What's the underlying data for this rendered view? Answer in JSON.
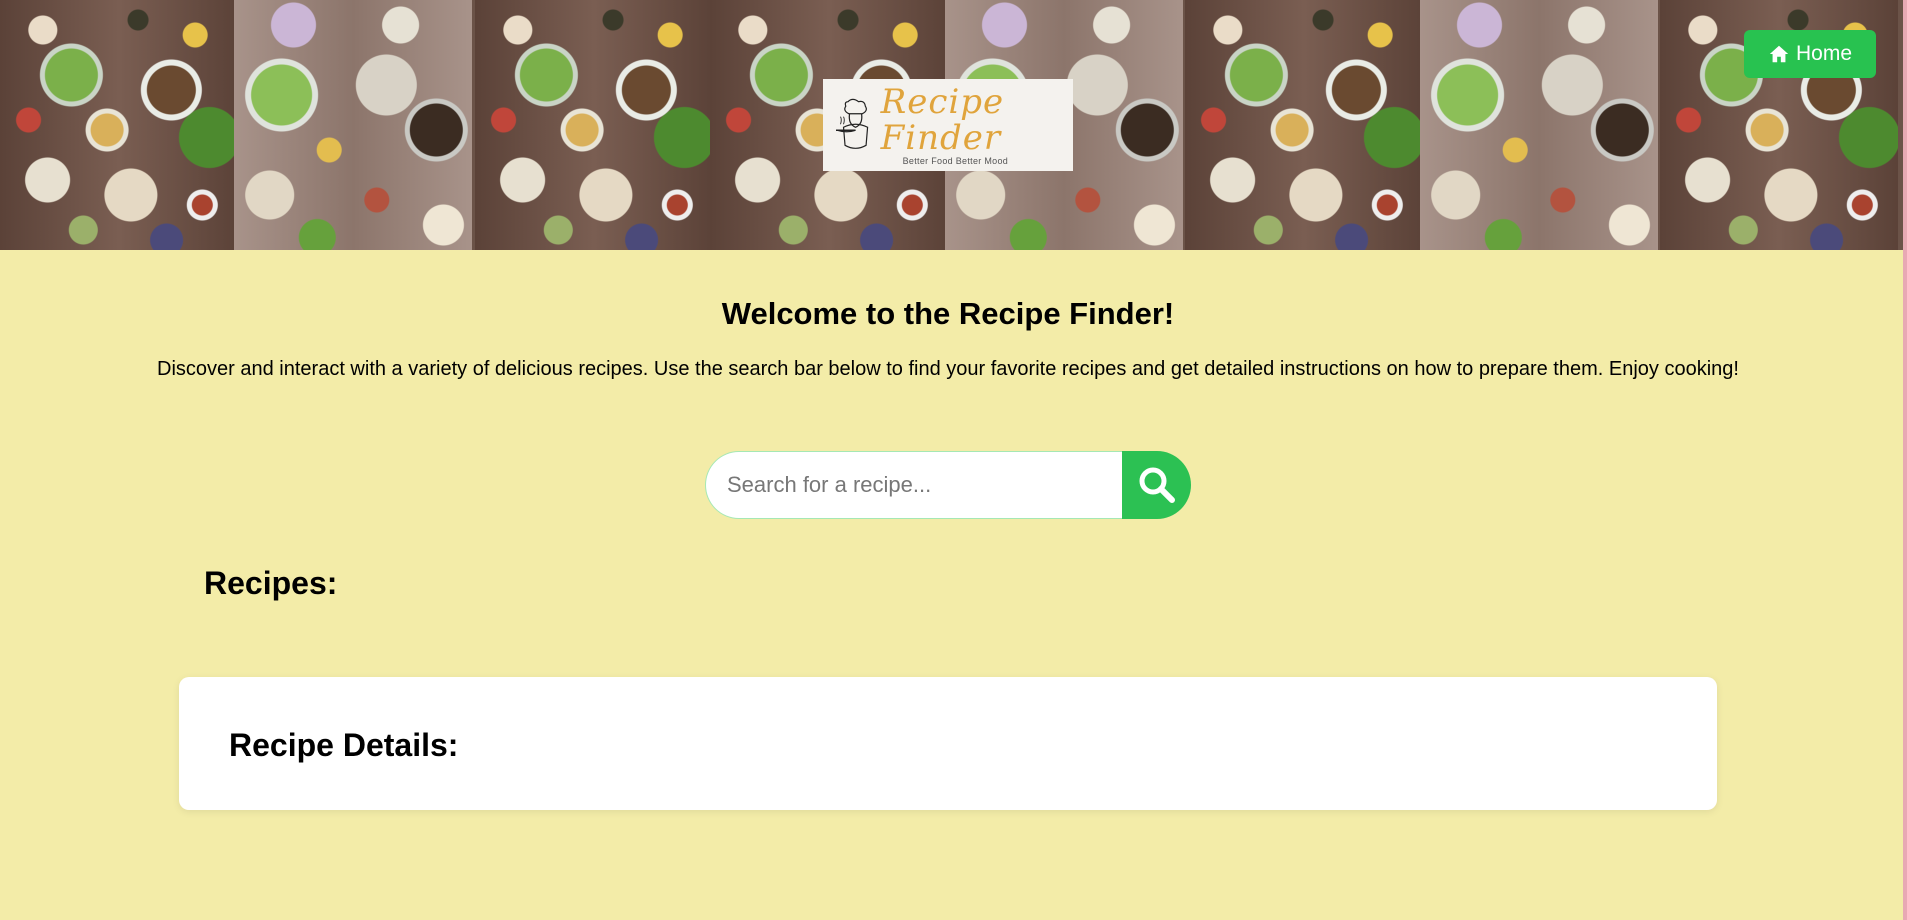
{
  "header": {
    "logo": {
      "title": "Recipe Finder",
      "tagline": "Better Food Better Mood",
      "icon": "chef-icon"
    },
    "home_button": {
      "label": "Home",
      "icon": "home-icon"
    },
    "banner_image": "table-of-dishes-photo"
  },
  "main": {
    "title": "Welcome to the Recipe Finder!",
    "subtitle": "Discover and interact with a variety of delicious recipes. Use the search bar below to find your favorite recipes and get detailed instructions on how to prepare them. Enjoy cooking!",
    "search": {
      "placeholder": "Search for a recipe...",
      "value": "",
      "button_icon": "search-icon"
    },
    "recipes_heading": "Recipes:",
    "details_heading": "Recipe Details:"
  },
  "colors": {
    "background": "#f3eca8",
    "accent_green": "#2cc153",
    "logo_gold": "#e0a43c",
    "card": "#ffffff"
  }
}
